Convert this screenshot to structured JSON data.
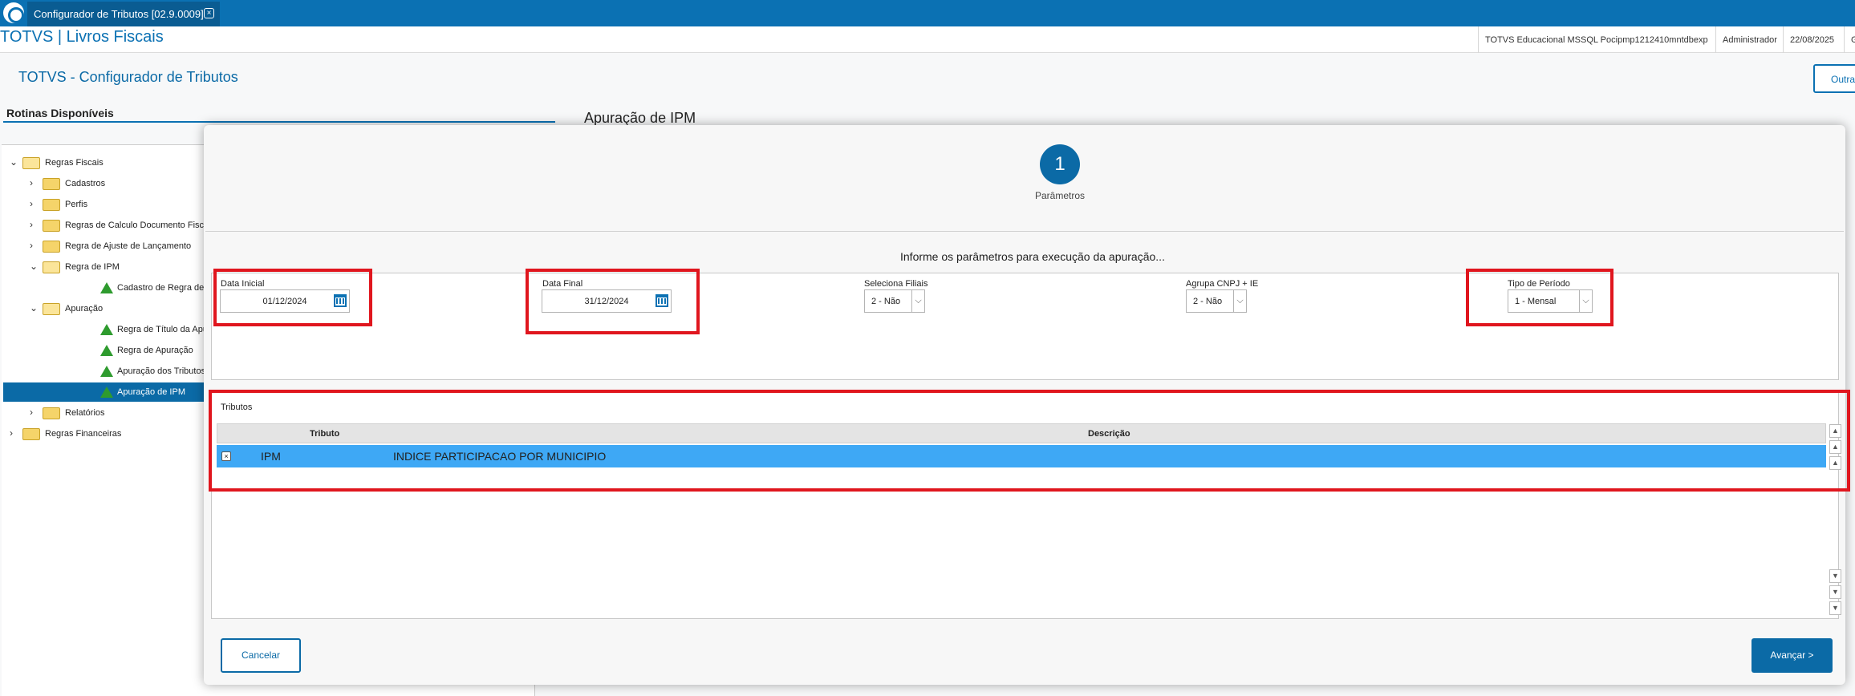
{
  "window": {
    "tab_title": "Configurador de Tributos [02.9.0009]"
  },
  "header": {
    "app_title": "TOTVS | Livros Fiscais",
    "environment": "TOTVS Educacional MSSQL Pocipmp1212410mntdbexp",
    "user": "Administrador",
    "date": "22/08/2025",
    "extra": "G"
  },
  "page": {
    "title": "TOTVS - Configurador de Tributos",
    "outras_button": "Outras",
    "apuracao_title": "Apuração de IPM"
  },
  "sidebar": {
    "title": "Rotinas Disponíveis",
    "items": [
      {
        "label": "Regras Fiscais",
        "icon": "folder-open-icon",
        "level": 0
      },
      {
        "label": "Cadastros",
        "icon": "folder-icon",
        "level": 1
      },
      {
        "label": "Perfis",
        "icon": "folder-icon",
        "level": 1
      },
      {
        "label": "Regras de Calculo Documento Fiscal",
        "icon": "folder-icon",
        "level": 1
      },
      {
        "label": "Regra de Ajuste de Lançamento",
        "icon": "folder-icon",
        "level": 1
      },
      {
        "label": "Regra de IPM",
        "icon": "folder-open-icon",
        "level": 1
      },
      {
        "label": "Cadastro de Regra de IPM",
        "icon": "triangle-icon",
        "level": 2
      },
      {
        "label": "Apuração",
        "icon": "folder-open-icon",
        "level": 1
      },
      {
        "label": "Regra de Título da Apuração",
        "icon": "triangle-icon",
        "level": 2
      },
      {
        "label": "Regra de Apuração",
        "icon": "triangle-icon",
        "level": 2
      },
      {
        "label": "Apuração dos Tributos Genéricos",
        "icon": "triangle-icon",
        "level": 2
      },
      {
        "label": "Apuração de IPM",
        "icon": "triangle-icon",
        "level": 2,
        "selected": true
      },
      {
        "label": "Relatórios",
        "icon": "folder-icon",
        "level": 1
      },
      {
        "label": "Regras Financeiras",
        "icon": "folder-icon",
        "level": 0
      }
    ]
  },
  "wizard": {
    "step_number": "1",
    "step_label": "Parâmetros",
    "subtitle": "Informe os parâmetros para execução da apuração...",
    "params": {
      "data_inicial": {
        "label": "Data Inicial",
        "value": "01/12/2024"
      },
      "data_final": {
        "label": "Data Final",
        "value": "31/12/2024"
      },
      "seleciona_filiais": {
        "label": "Seleciona Filiais",
        "value": "2 - Não"
      },
      "agrupa_cnpj": {
        "label": "Agrupa CNPJ + IE",
        "value": "2 - Não"
      },
      "tipo_periodo": {
        "label": "Tipo de Período",
        "value": "1 - Mensal"
      }
    },
    "tributos": {
      "label": "Tributos",
      "columns": [
        "Tributo",
        "Descrição"
      ],
      "rows": [
        {
          "tributo": "IPM",
          "descricao": "INDICE PARTICIPACAO POR MUNICIPIO"
        }
      ]
    },
    "cancel_label": "Cancelar",
    "next_label": "Avançar >"
  },
  "colors": {
    "accent": "#0b71b3",
    "highlight": "#e0161e",
    "selected_row": "#3ea8f5"
  }
}
